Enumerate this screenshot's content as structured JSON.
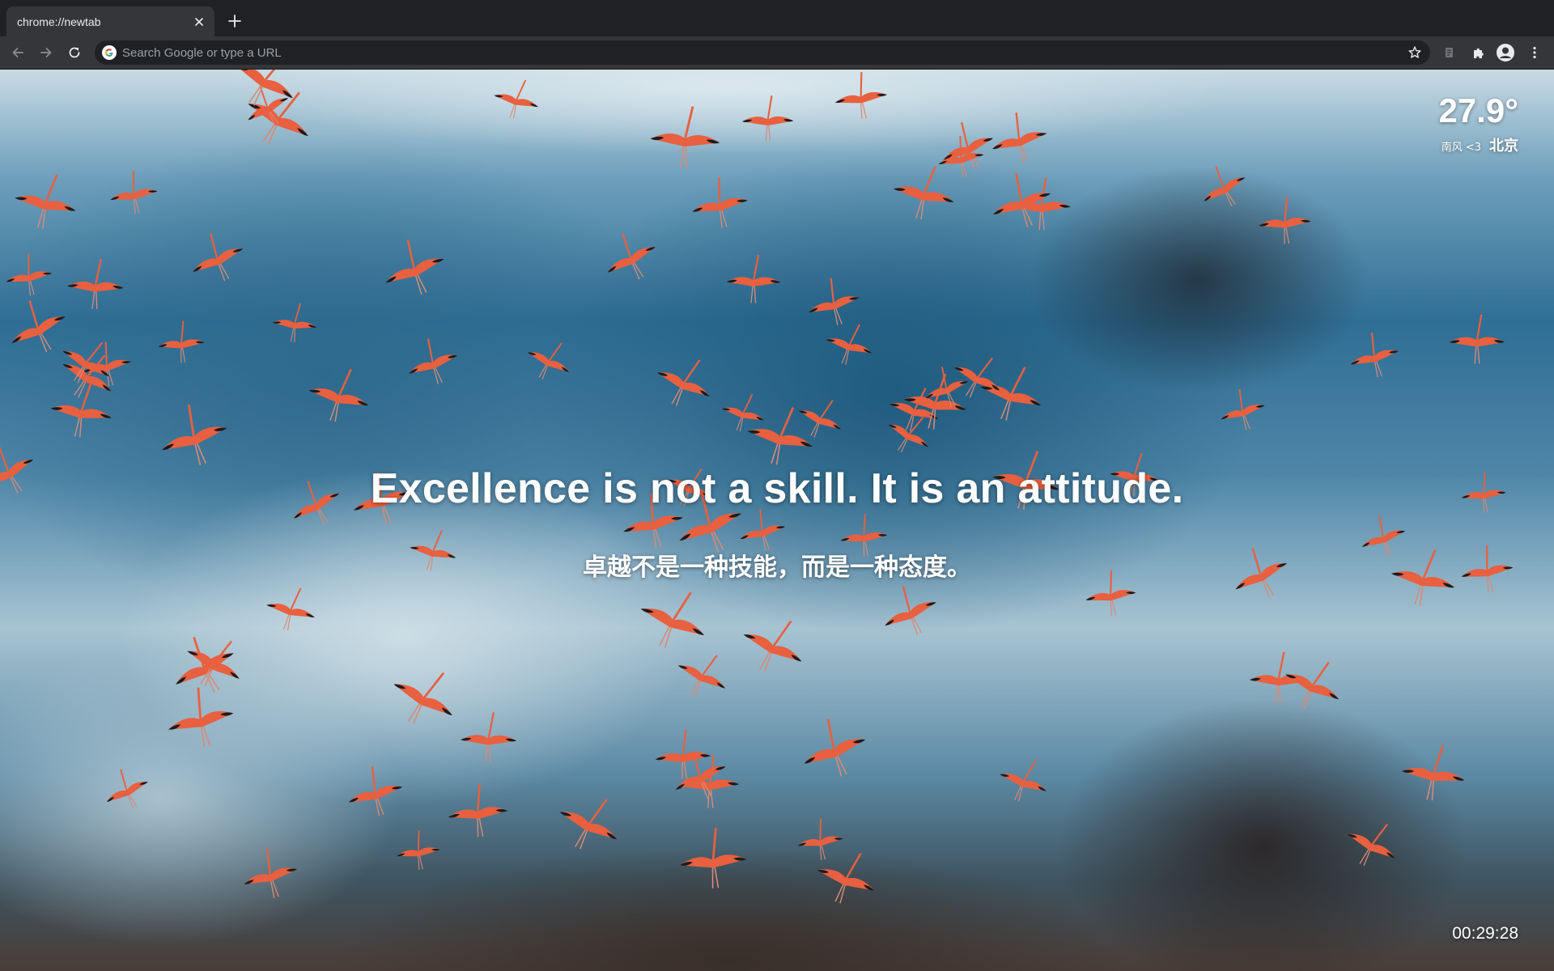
{
  "tab": {
    "title": "chrome://newtab"
  },
  "omnibox": {
    "placeholder": "Search Google or type a URL"
  },
  "toolbar": {
    "icons": [
      "back-icon",
      "forward-icon",
      "reload-icon",
      "google-icon",
      "bookmark-star-icon",
      "reading-list-icon",
      "extensions-puzzle-icon",
      "profile-avatar-icon",
      "more-menu-icon"
    ]
  },
  "quote": {
    "english": "Excellence is not a skill. It is an attitude.",
    "chinese": "卓越不是一种技能，而是一种态度。"
  },
  "weather": {
    "temperature": "27.9°",
    "wind": "南风 <3",
    "city": "北京"
  },
  "clock": {
    "time": "00:29:28"
  },
  "colors": {
    "tabstrip": "#202124",
    "active_tab": "#35363a",
    "toolbar": "#35363a",
    "omnibox": "#202124",
    "icon": "#e8eaed",
    "flamingo": "#e8603f"
  }
}
